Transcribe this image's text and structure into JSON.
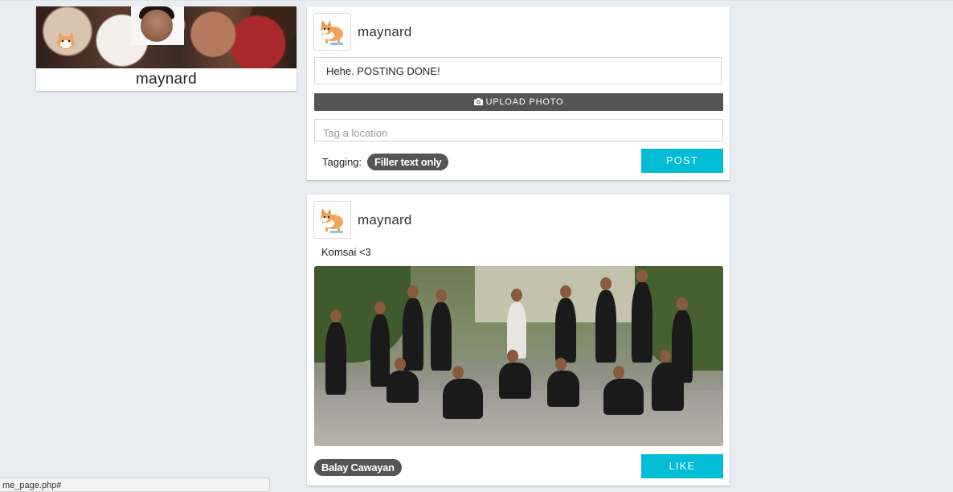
{
  "profile": {
    "name": "maynard"
  },
  "compose": {
    "username": "maynard",
    "text_value": "Hehe. POSTING DONE!",
    "upload_label": "UPLOAD PHOTO",
    "location_placeholder": "Tag a location",
    "tagging_label": "Tagging:",
    "tag": "Filler text only",
    "post_label": "POST"
  },
  "post": {
    "username": "maynard",
    "caption": "Komsai <3",
    "location": "Balay Cawayan",
    "like_label": "LIKE"
  },
  "statusbar": {
    "url": "me_page.php#"
  },
  "colors": {
    "accent": "#00bcd4",
    "dark_button": "#555555",
    "background": "#e9edf1"
  },
  "icons": {
    "camera": "camera-icon",
    "avatar": "corgi-avatar"
  }
}
